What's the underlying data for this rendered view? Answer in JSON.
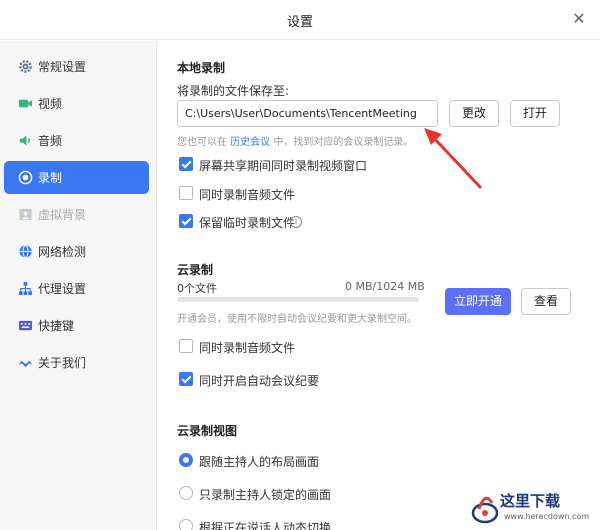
{
  "window": {
    "title": "设置"
  },
  "sidebar": {
    "items": [
      {
        "label": "常规设置",
        "icon": "gear-icon"
      },
      {
        "label": "视频",
        "icon": "video-icon"
      },
      {
        "label": "音频",
        "icon": "speaker-icon"
      },
      {
        "label": "录制",
        "icon": "record-icon",
        "active": true
      },
      {
        "label": "虚拟背景",
        "icon": "portrait-icon",
        "disabled": true
      },
      {
        "label": "网络检测",
        "icon": "globe-icon"
      },
      {
        "label": "代理设置",
        "icon": "network-icon"
      },
      {
        "label": "快捷键",
        "icon": "keyboard-icon"
      },
      {
        "label": "关于我们",
        "icon": "logo-icon"
      }
    ]
  },
  "local_recording": {
    "title": "本地录制",
    "save_label": "将录制的文件保存至:",
    "path_value": "C:\\Users\\User\\Documents\\TencentMeeting",
    "change_button": "更改",
    "open_button": "打开",
    "hint_prefix": "您也可以在",
    "hint_link": "历史会议",
    "hint_suffix": "中，找到对应的会议录制记录。",
    "options": [
      {
        "label": "屏幕共享期间同时录制视频窗口",
        "checked": true
      },
      {
        "label": "同时录制音频文件",
        "checked": false
      },
      {
        "label": "保留临时录制文件",
        "checked": true
      }
    ]
  },
  "cloud_recording": {
    "title": "云录制",
    "file_count": "0个文件",
    "usage": "0 MB/1024 MB",
    "usage_fraction": 0,
    "hint": "开通会员，使用不限时自动会议纪要和更大录制空间。",
    "activate_button": "立即开通",
    "view_button": "查看",
    "options": [
      {
        "label": "同时录制音频文件",
        "checked": false
      },
      {
        "label": "同时开启自动会议纪要",
        "checked": true
      }
    ]
  },
  "cloud_view": {
    "title": "云录制视图",
    "options": [
      {
        "label": "跟随主持人的布局画面",
        "selected": true
      },
      {
        "label": "只录制主持人锁定的画面",
        "selected": false
      },
      {
        "label": "根据正在说话人动态切换",
        "selected": false
      }
    ]
  },
  "colors": {
    "accent": "#3a78f2",
    "primary_button": "#5a70f6",
    "annotation_arrow": "#e8332a"
  },
  "watermark": {
    "text": "这里下载",
    "url": "www.herecdown.com"
  }
}
